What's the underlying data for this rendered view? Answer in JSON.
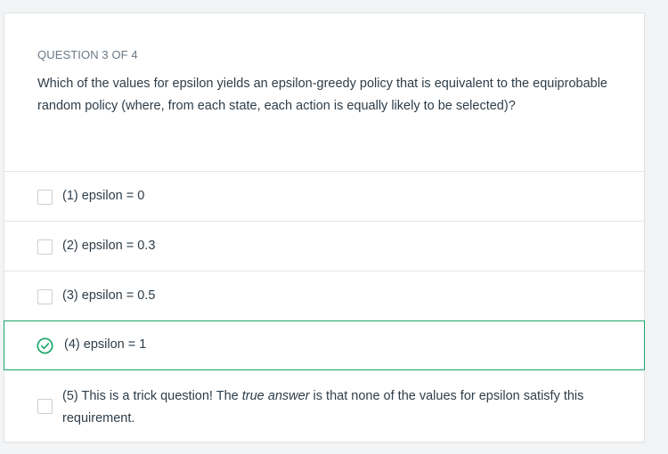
{
  "question": {
    "number_label": "QUESTION 3 OF 4",
    "text": "Which of the values for epsilon yields an epsilon-greedy policy that is equivalent to the equiprobable random policy (where, from each state, each action is equally likely to be selected)?"
  },
  "options": [
    {
      "label": "(1) epsilon = 0",
      "selected": false
    },
    {
      "label": "(2) epsilon = 0.3",
      "selected": false
    },
    {
      "label": "(3) epsilon = 0.5",
      "selected": false
    },
    {
      "label": "(4) epsilon = 1",
      "selected": true,
      "icon": "check-circle-icon"
    },
    {
      "label_before": "(5) This is a trick question! The ",
      "label_emphasis": "true answer",
      "label_after": " is that none of the values for epsilon satisfy this requirement.",
      "selected": false
    }
  ],
  "colors": {
    "correct_accent": "#1aa86a",
    "text": "#2e3d49",
    "muted": "#6b7885"
  }
}
